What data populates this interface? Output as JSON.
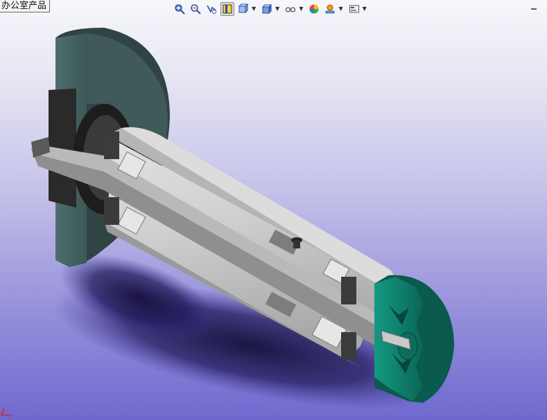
{
  "window": {
    "tab_label": "办公室产品"
  },
  "toolbar": {
    "buttons": [
      {
        "name": "zoom-to-fit",
        "icon": "zoom-fit-icon"
      },
      {
        "name": "zoom-to-area",
        "icon": "zoom-area-icon"
      },
      {
        "name": "previous-view",
        "icon": "previous-view-icon"
      },
      {
        "name": "section-view",
        "icon": "section-view-icon",
        "active": true
      },
      {
        "name": "view-orientation",
        "icon": "view-orientation-icon",
        "dropdown": true
      },
      {
        "name": "display-style",
        "icon": "display-style-icon",
        "dropdown": true
      },
      {
        "name": "hide-show-items",
        "icon": "hide-show-icon",
        "dropdown": true
      },
      {
        "name": "edit-appearance",
        "icon": "appearance-icon"
      },
      {
        "name": "apply-scene",
        "icon": "scene-icon",
        "dropdown": true
      },
      {
        "name": "view-settings",
        "icon": "view-settings-icon",
        "dropdown": true
      }
    ]
  },
  "colors": {
    "background_top": "#f6f6fb",
    "background_bottom": "#6f69cf",
    "flange": "#4e7372",
    "end_cap": "#0f7a69",
    "shaft_light": "#c9c9c9",
    "shaft_dark": "#8e8e8e"
  }
}
